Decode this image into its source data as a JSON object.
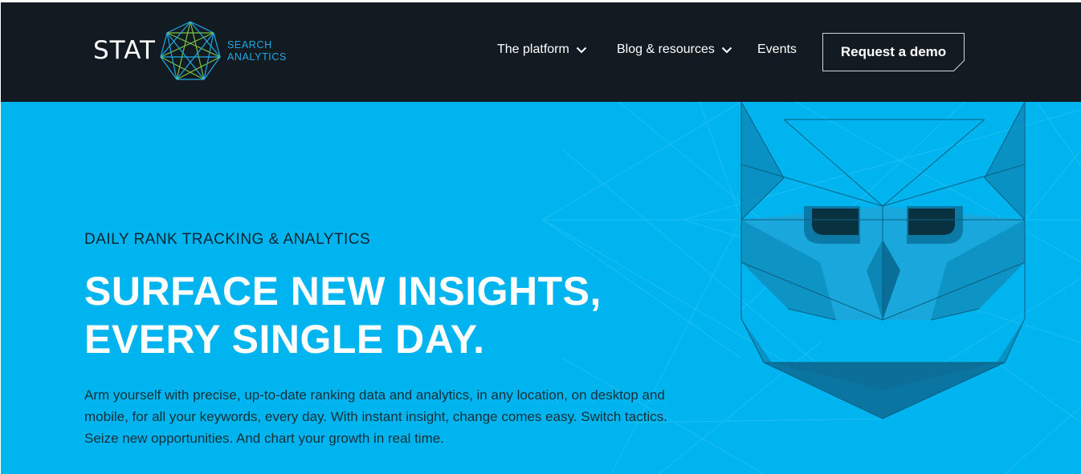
{
  "brand": {
    "wordmark": "STAT",
    "subline_1": "SEARCH",
    "subline_2": "ANALYTICS",
    "colors": {
      "header_bg": "#121b21",
      "hero_bg": "#00b5ef",
      "accent_blue": "#1fa9e6",
      "accent_green": "#7cc243"
    }
  },
  "nav": {
    "items": [
      {
        "label": "The platform",
        "icon": "chevron-down-icon"
      },
      {
        "label": "Blog & resources",
        "icon": "chevron-down-icon"
      },
      {
        "label": "Events"
      }
    ],
    "cta_label": "Request a demo"
  },
  "hero": {
    "eyebrow": "DAILY RANK TRACKING & ANALYTICS",
    "headline_line_1": "SURFACE NEW INSIGHTS,",
    "headline_line_2": "EVERY SINGLE DAY.",
    "body": "Arm yourself with precise, up-to-date ranking data and analytics, in any location, on desktop and mobile, for all your keywords, every day. With instant insight, change comes easy. Switch tactics. Seize new opportunities. And chart your growth in real time.",
    "illustration": "owl-illustration"
  }
}
